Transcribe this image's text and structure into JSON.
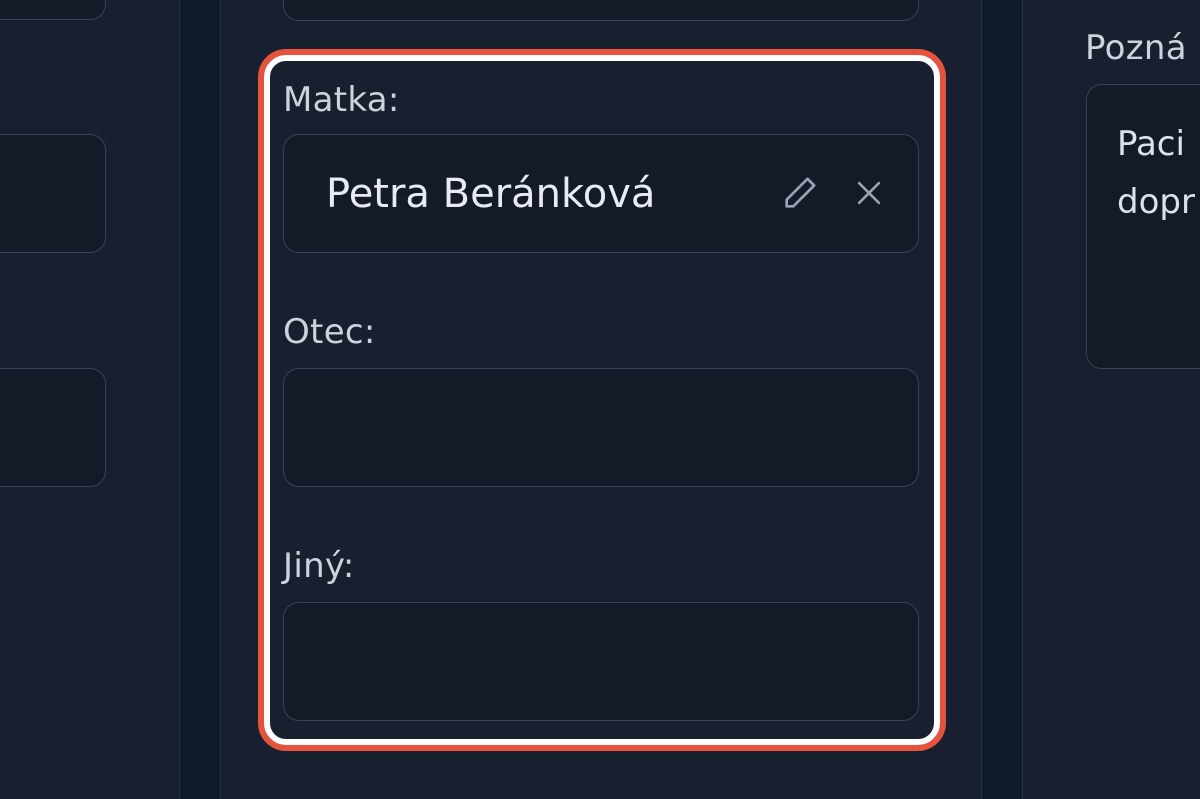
{
  "form": {
    "mother": {
      "label": "Matka:",
      "value": "Petra Beránková"
    },
    "father": {
      "label": "Otec:",
      "value": ""
    },
    "other": {
      "label": "Jiný:",
      "value": ""
    }
  },
  "notes": {
    "label": "Pozná",
    "text_line1": "Paci",
    "text_line2": "dopr"
  },
  "icons": {
    "edit": "pencil-icon",
    "remove": "close-icon"
  },
  "colors": {
    "background": "#111a29",
    "panel": "#18202f",
    "field": "#131a28",
    "highlight_inner": "#ffffff",
    "highlight_outer": "#e5533f"
  }
}
